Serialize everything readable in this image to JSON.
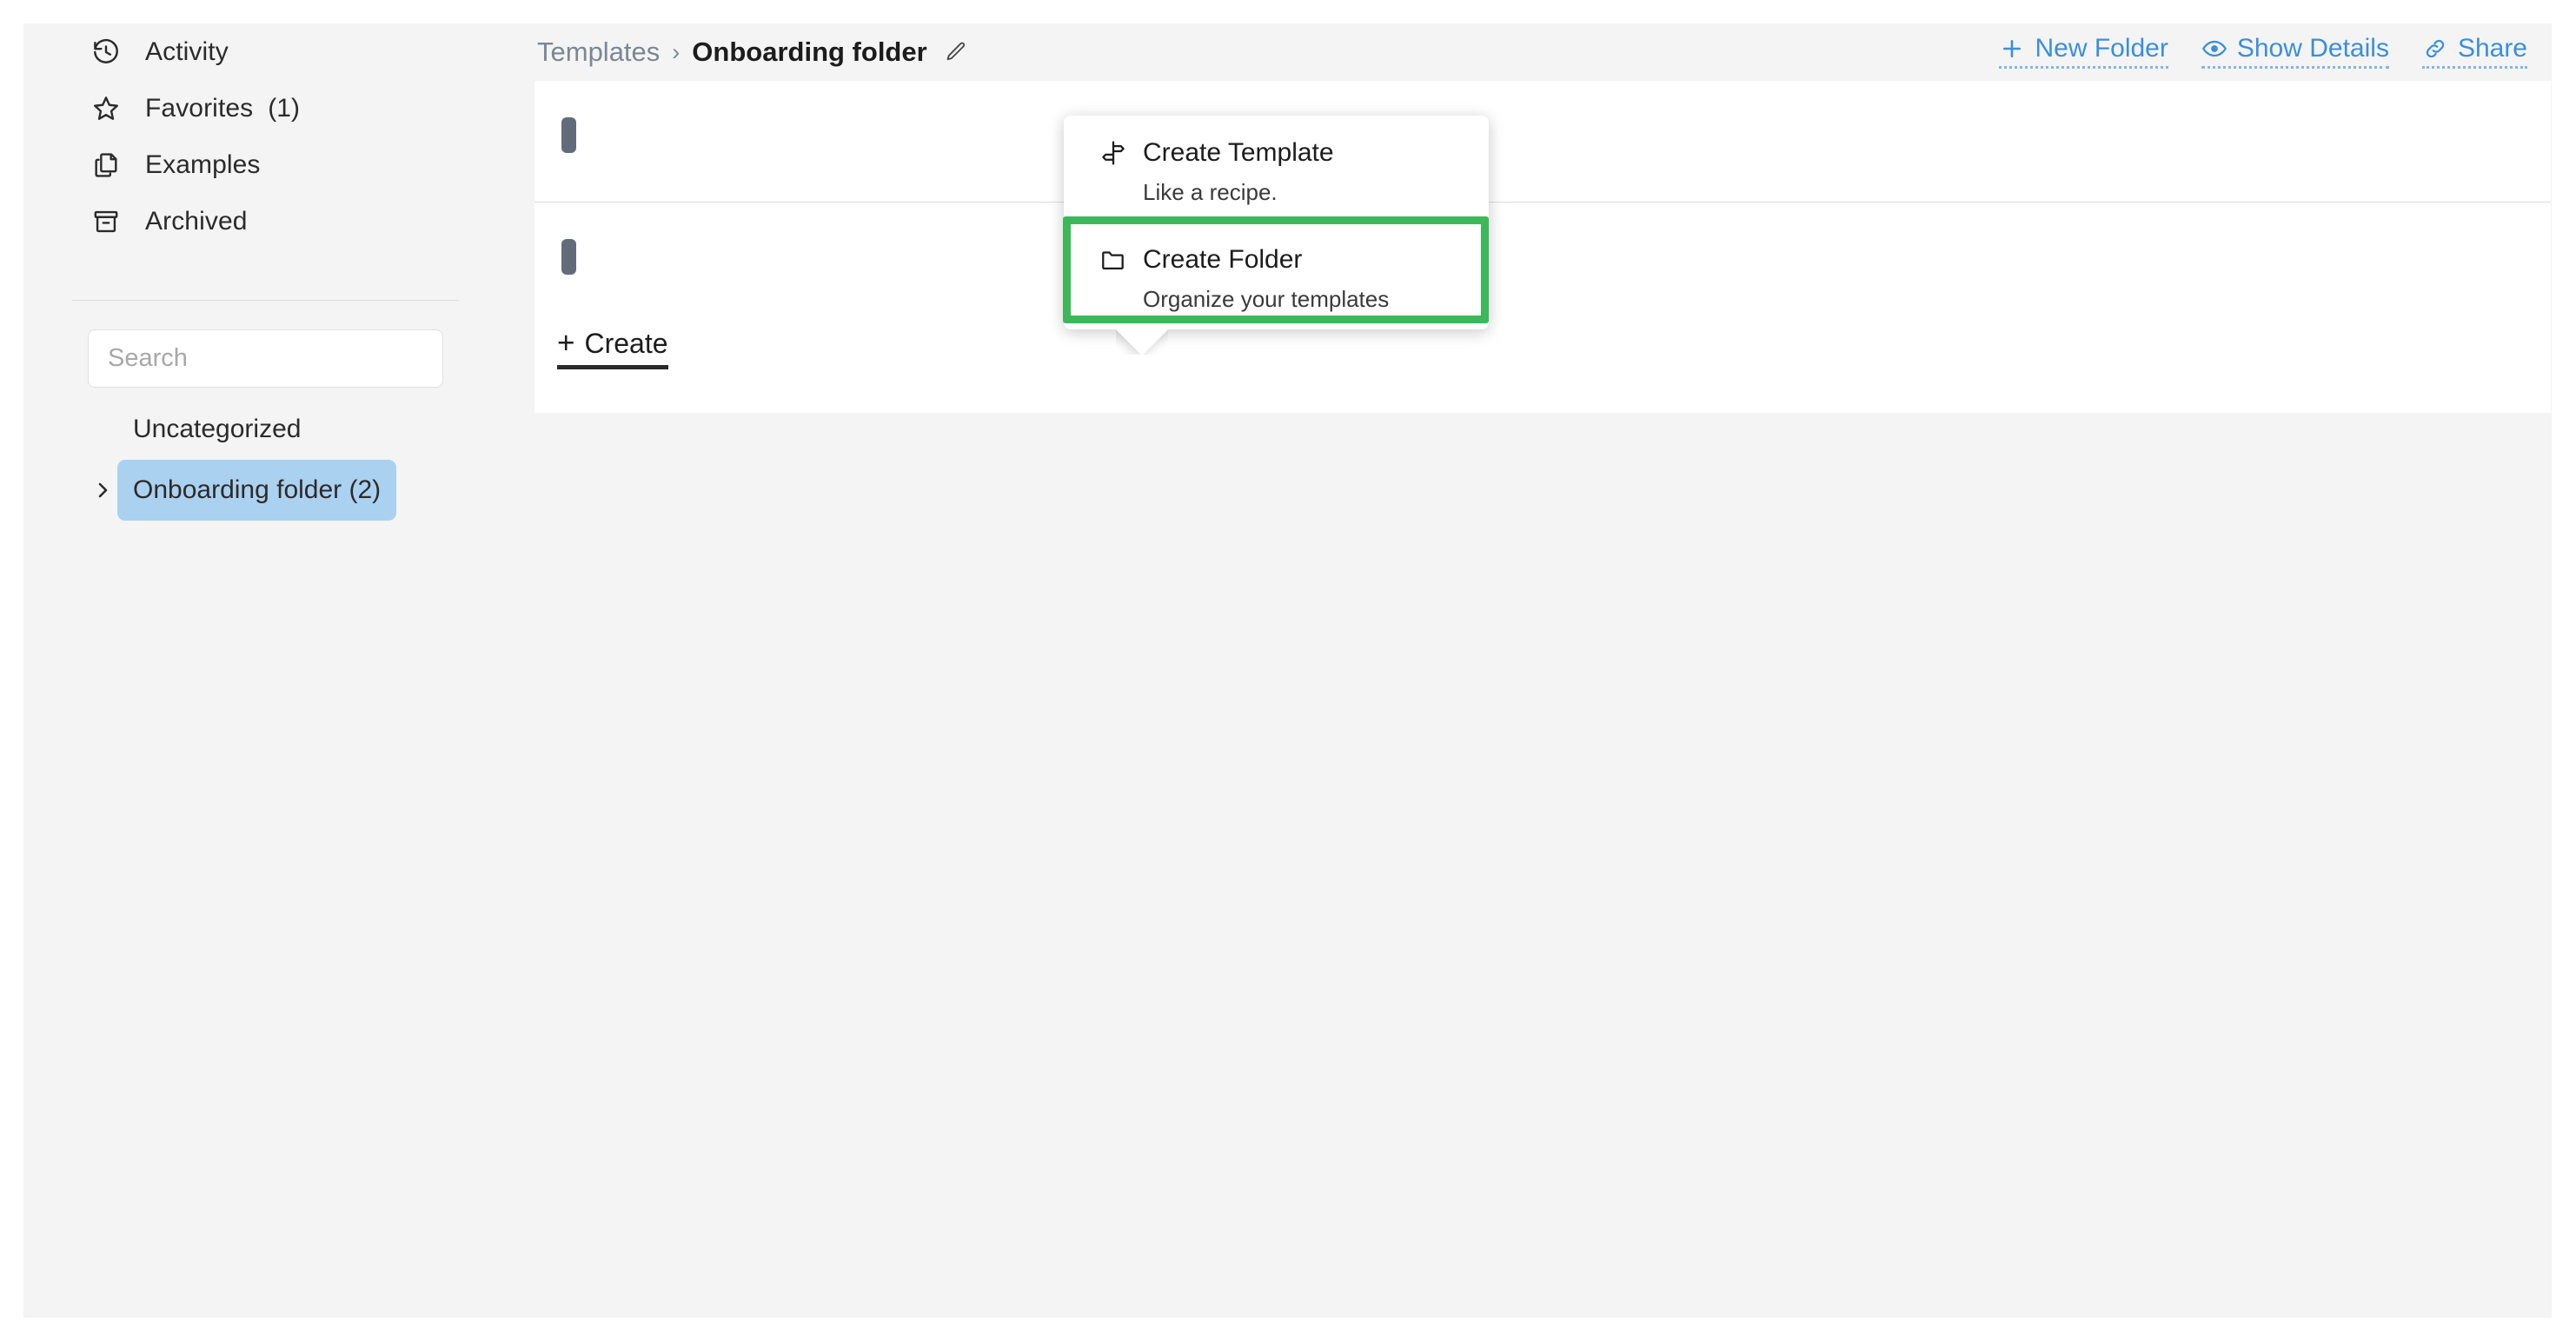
{
  "sidebar": {
    "nav_items": [
      {
        "label": "Activity",
        "icon": "history-icon",
        "count": ""
      },
      {
        "label": "Favorites",
        "icon": "star-icon",
        "count": "(1)"
      },
      {
        "label": "Examples",
        "icon": "copy-icon",
        "count": ""
      },
      {
        "label": "Archived",
        "icon": "archive-icon",
        "count": ""
      }
    ],
    "search": {
      "value": "",
      "placeholder": "Search"
    },
    "folders": [
      {
        "label": "Uncategorized",
        "selected": false,
        "has_chevron": false
      },
      {
        "label": "Onboarding folder (2)",
        "selected": true,
        "has_chevron": true
      }
    ]
  },
  "header": {
    "breadcrumb": {
      "root": "Templates",
      "separator": "›",
      "current": "Onboarding folder",
      "edit_icon": "pencil-icon"
    },
    "actions": [
      {
        "label": "New Folder",
        "icon": "plus-icon"
      },
      {
        "label": "Show Details",
        "icon": "eye-icon"
      },
      {
        "label": "Share",
        "icon": "link-icon"
      }
    ]
  },
  "main": {
    "create_button": {
      "plus": "+",
      "label": "Create"
    },
    "popup": {
      "items": [
        {
          "title": "Create Template",
          "subtitle": "Like a recipe.",
          "icon": "signpost-icon",
          "highlighted": false
        },
        {
          "title": "Create Folder",
          "subtitle": "Organize your templates",
          "icon": "folder-icon",
          "highlighted": true
        }
      ]
    }
  },
  "colors": {
    "app_background": "#f4f4f4",
    "panel_background": "#ffffff",
    "accent_link": "#3b8ede",
    "selected_folder": "#abd1f0",
    "highlight_border": "#3cb85a",
    "row_marker": "#636b7a",
    "text_primary": "#1c1c1c",
    "text_muted": "#7b8794"
  }
}
